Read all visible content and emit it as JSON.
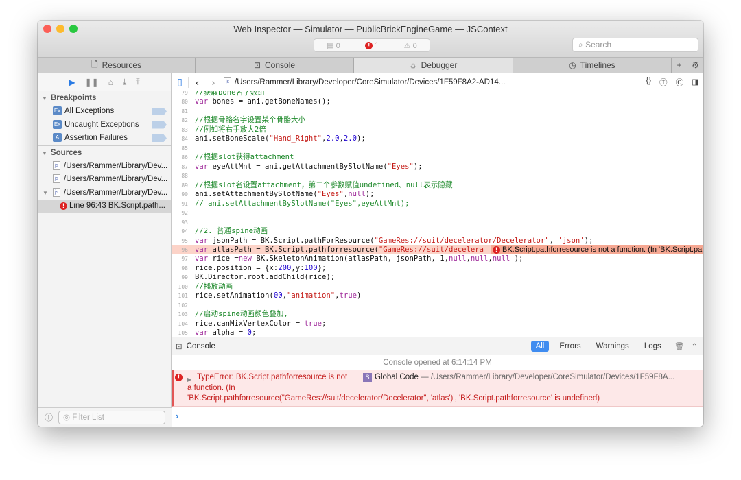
{
  "window": {
    "title": "Web Inspector — Simulator — PublicBrickEngineGame — JSContext"
  },
  "status": {
    "logs": "0",
    "errors": "1",
    "warnings": "0"
  },
  "search": {
    "placeholder": "Search"
  },
  "tabs": [
    {
      "label": "Resources",
      "icon": "document-icon"
    },
    {
      "label": "Console",
      "icon": "console-icon"
    },
    {
      "label": "Debugger",
      "icon": "bug-icon",
      "active": true
    },
    {
      "label": "Timelines",
      "icon": "clock-icon"
    }
  ],
  "sidebar": {
    "breakpoints_title": "Breakpoints",
    "breakpoints": [
      {
        "badge": "Ex",
        "label": "All Exceptions"
      },
      {
        "badge": "Ex",
        "label": "Uncaught Exceptions"
      },
      {
        "badge": "A",
        "label": "Assertion Failures"
      }
    ],
    "sources_title": "Sources",
    "sources": [
      "/Users/Rammer/Library/Dev...",
      "/Users/Rammer/Library/Dev...",
      "/Users/Rammer/Library/Dev..."
    ],
    "issue": "Line 96:43 BK.Script.path...",
    "filter_placeholder": "Filter List"
  },
  "pathbar": {
    "path": "/Users/Rammer/Library/Developer/CoreSimulator/Devices/1F59F8A2-AD14..."
  },
  "code": [
    {
      "n": "79",
      "t": [
        [
          "c",
          "//获取bone名字数组"
        ]
      ]
    },
    {
      "n": "80",
      "t": [
        [
          "k",
          "var"
        ],
        [
          "p",
          " bones = ani.getBoneNames();"
        ]
      ]
    },
    {
      "n": "81",
      "t": []
    },
    {
      "n": "82",
      "t": [
        [
          "c",
          "//根据骨骼名字设置某个骨骼大小"
        ]
      ]
    },
    {
      "n": "83",
      "t": [
        [
          "c",
          "//例如将右手放大2倍"
        ]
      ]
    },
    {
      "n": "84",
      "t": [
        [
          "p",
          "ani.setBoneScale("
        ],
        [
          "s",
          "\"Hand_Right\""
        ],
        [
          "p",
          ","
        ],
        [
          "n",
          "2.0"
        ],
        [
          "p",
          ","
        ],
        [
          "n",
          "2.0"
        ],
        [
          "p",
          ");"
        ]
      ]
    },
    {
      "n": "85",
      "t": []
    },
    {
      "n": "86",
      "t": [
        [
          "c",
          "//根据slot获得attachment"
        ]
      ]
    },
    {
      "n": "87",
      "t": [
        [
          "k",
          "var"
        ],
        [
          "p",
          " eyeAttMnt = ani.getAttachmentBySlotName("
        ],
        [
          "s",
          "\"Eyes\""
        ],
        [
          "p",
          ");"
        ]
      ]
    },
    {
      "n": "88",
      "t": []
    },
    {
      "n": "89",
      "t": [
        [
          "c",
          "//根据slot名设置attachment，第二个参数赋值undefined、null表示隐藏"
        ]
      ]
    },
    {
      "n": "90",
      "t": [
        [
          "p",
          "ani.setAttachmentBySlotName("
        ],
        [
          "s",
          "\"Eyes\""
        ],
        [
          "p",
          ","
        ],
        [
          "k",
          "null"
        ],
        [
          "p",
          ");"
        ]
      ]
    },
    {
      "n": "91",
      "t": [
        [
          "c",
          "// ani.setAttachmentBySlotName(\"Eyes\",eyeAttMnt);"
        ]
      ]
    },
    {
      "n": "92",
      "t": []
    },
    {
      "n": "93",
      "t": []
    },
    {
      "n": "94",
      "t": [
        [
          "c",
          "//2. 普通spine动画"
        ]
      ]
    },
    {
      "n": "95",
      "t": [
        [
          "k",
          "var"
        ],
        [
          "p",
          " jsonPath = BK.Script.pathForResource("
        ],
        [
          "s",
          "\"GameRes://suit/decelerator/Decelerator\""
        ],
        [
          "p",
          ", "
        ],
        [
          "s",
          "'json'"
        ],
        [
          "p",
          ");"
        ]
      ]
    },
    {
      "n": "96",
      "hl": true,
      "t": [
        [
          "k",
          "var"
        ],
        [
          "p",
          " atlasPath = BK.Script.pathforresource("
        ],
        [
          "s",
          "\"GameRes://suit/decelera"
        ]
      ],
      "error": "BK.Script.pathforresource is not a function. (In 'BK.Script.pathforresource"
    },
    {
      "n": "97",
      "t": [
        [
          "k",
          "var"
        ],
        [
          "p",
          " rice ="
        ],
        [
          "k",
          "new"
        ],
        [
          "p",
          " BK.SkeletonAnimation(atlasPath, jsonPath, 1,"
        ],
        [
          "k",
          "null"
        ],
        [
          "p",
          ","
        ],
        [
          "k",
          "null"
        ],
        [
          "p",
          ","
        ],
        [
          "k",
          "null"
        ],
        [
          "p",
          " );"
        ]
      ]
    },
    {
      "n": "98",
      "t": [
        [
          "p",
          "rice.position = {x:"
        ],
        [
          "n",
          "200"
        ],
        [
          "p",
          ",y:"
        ],
        [
          "n",
          "100"
        ],
        [
          "p",
          "};"
        ]
      ]
    },
    {
      "n": "99",
      "t": [
        [
          "p",
          "BK.Director.root.addChild(rice);"
        ]
      ]
    },
    {
      "n": "100",
      "t": [
        [
          "c",
          "//播放动画"
        ]
      ]
    },
    {
      "n": "101",
      "t": [
        [
          "p",
          "rice.setAnimation("
        ],
        [
          "n",
          "00"
        ],
        [
          "p",
          ","
        ],
        [
          "s",
          "\"animation\""
        ],
        [
          "p",
          ","
        ],
        [
          "k",
          "true"
        ],
        [
          "p",
          ")"
        ]
      ]
    },
    {
      "n": "102",
      "t": []
    },
    {
      "n": "103",
      "t": [
        [
          "c",
          "//启动spine动画颜色叠加,"
        ]
      ]
    },
    {
      "n": "104",
      "t": [
        [
          "p",
          "rice.canMixVertexColor = "
        ],
        [
          "k",
          "true"
        ],
        [
          "p",
          ";"
        ]
      ]
    },
    {
      "n": "105",
      "t": [
        [
          "k",
          "var"
        ],
        [
          "p",
          " alpha = "
        ],
        [
          "n",
          "0"
        ],
        [
          "p",
          ";"
        ]
      ]
    }
  ],
  "console": {
    "title": "Console",
    "filters": [
      "All",
      "Errors",
      "Warnings",
      "Logs"
    ],
    "opened": "Console opened at 6:14:14 PM",
    "error_line1": "TypeError: BK.Script.pathforresource is not",
    "error_line2": "a function. (In",
    "error_line3": "'BK.Script.pathforresource(\"GameRes://suit/decelerator/Decelerator\", 'atlas')', 'BK.Script.pathforresource' is undefined)",
    "scope_badge": "S",
    "scope": "Global Code",
    "location": "— /Users/Rammer/Library/Developer/CoreSimulator/Devices/1F59F8A..."
  }
}
